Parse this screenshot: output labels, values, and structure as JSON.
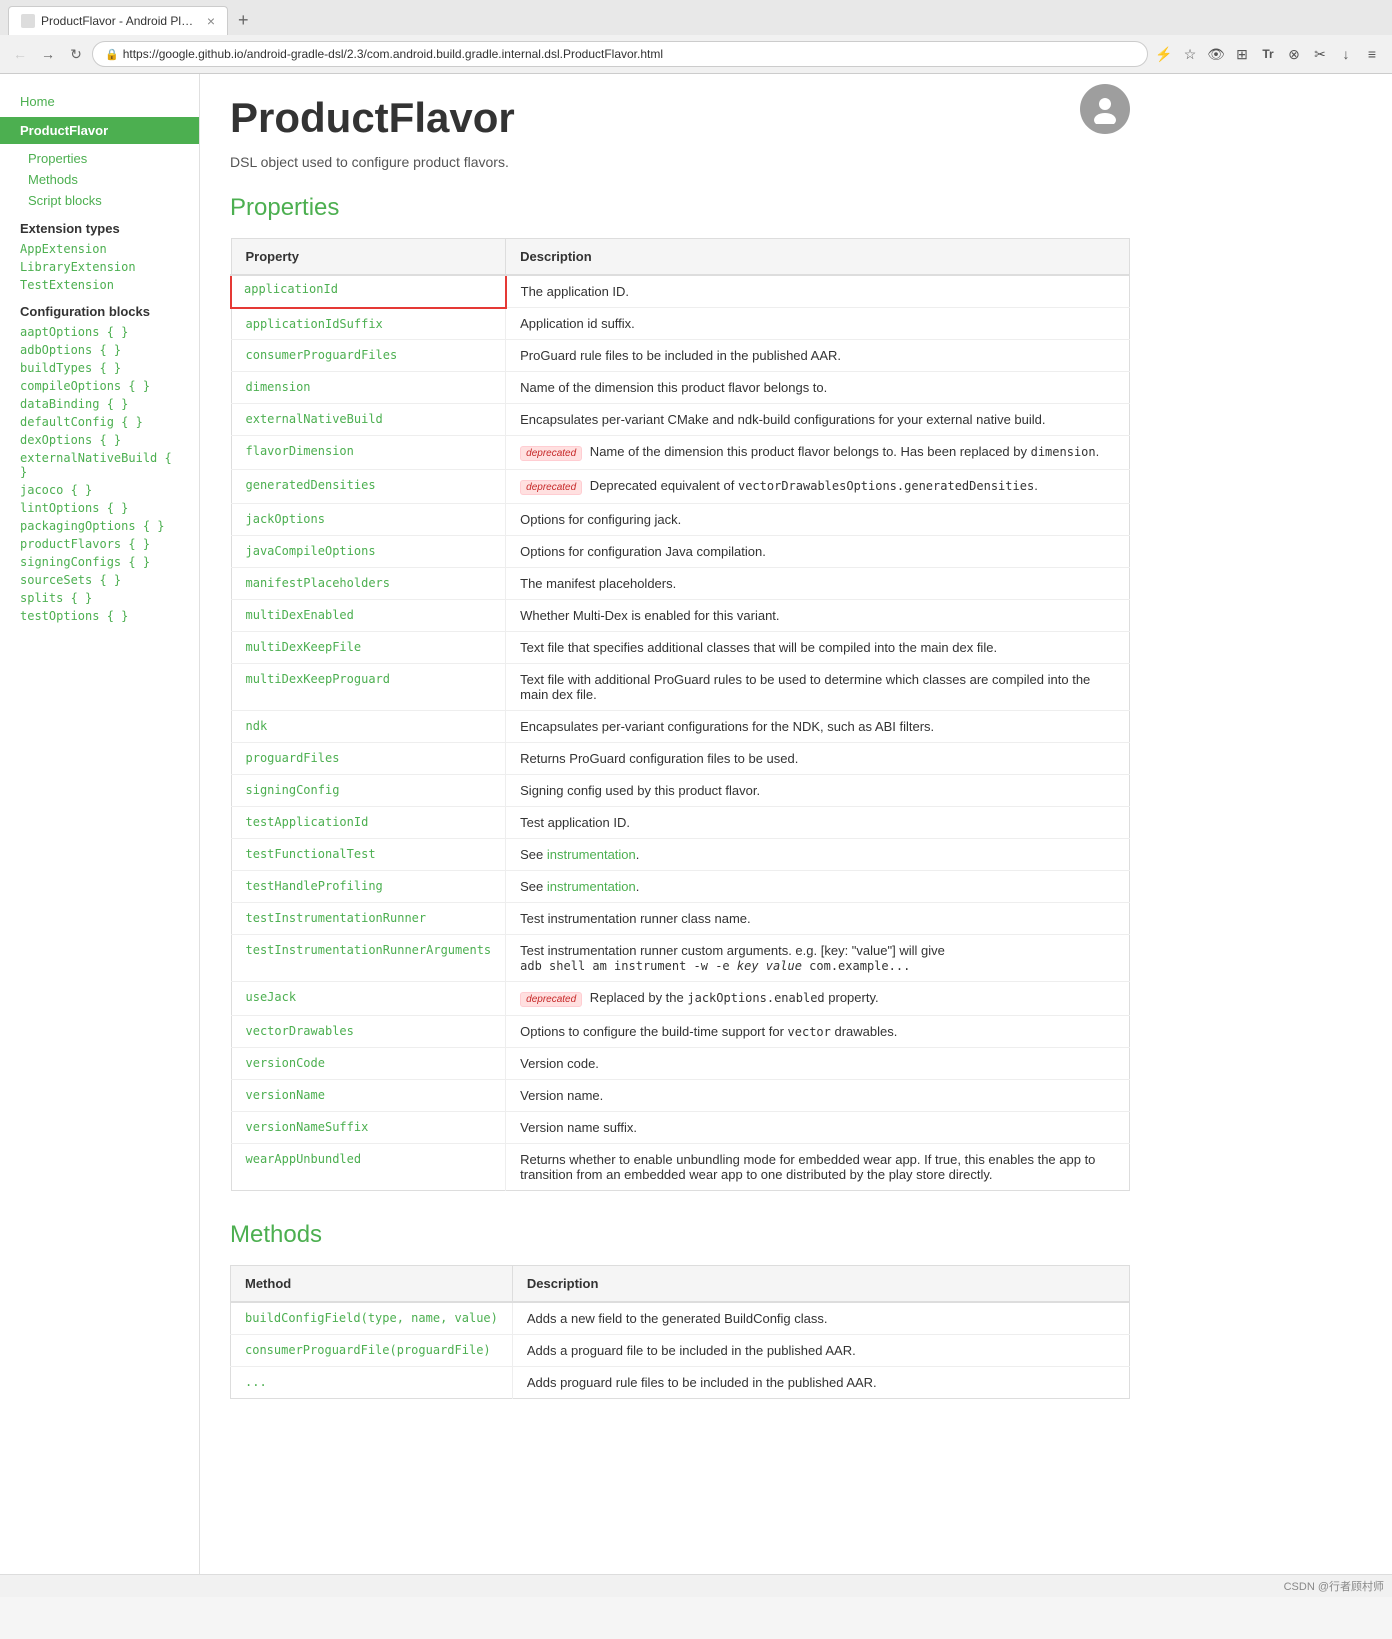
{
  "browser": {
    "tab_title": "ProductFlavor - Android Plugi...",
    "url": "https://google.github.io/android-gradle-dsl/2.3/com.android.build.gradle.internal.dsl.ProductFlavor.html",
    "nav_back": "←",
    "nav_forward": "→",
    "nav_refresh": "↻",
    "toolbar_icons": [
      "⚡",
      "☆",
      "👁",
      "⊞",
      "Tr",
      "⊗",
      "✂",
      "↓",
      "≡"
    ]
  },
  "sidebar": {
    "home_label": "Home",
    "active_label": "ProductFlavor",
    "sub_items": [
      "Properties",
      "Methods",
      "Script blocks"
    ],
    "extension_types_title": "Extension types",
    "extension_types": [
      "AppExtension",
      "LibraryExtension",
      "TestExtension"
    ],
    "config_blocks_title": "Configuration blocks",
    "config_blocks": [
      "aaptOptions { }",
      "adbOptions { }",
      "buildTypes { }",
      "compileOptions { }",
      "dataBinding { }",
      "defaultConfig { }",
      "dexOptions { }",
      "externalNativeBuild { }",
      "jacoco { }",
      "lintOptions { }",
      "packagingOptions { }",
      "productFlavors { }",
      "signingConfigs { }",
      "sourceSets { }",
      "splits { }",
      "testOptions { }"
    ]
  },
  "main": {
    "page_title": "ProductFlavor",
    "page_subtitle": "DSL object used to configure product flavors.",
    "properties_section_title": "Properties",
    "properties_table": {
      "col_property": "Property",
      "col_description": "Description",
      "rows": [
        {
          "property": "applicationId",
          "description": "The application ID.",
          "highlighted": true
        },
        {
          "property": "applicationIdSuffix",
          "description": "Application id suffix."
        },
        {
          "property": "consumerProguardFiles",
          "description": "ProGuard rule files to be included in the published AAR."
        },
        {
          "property": "dimension",
          "description": "Name of the dimension this product flavor belongs to."
        },
        {
          "property": "externalNativeBuild",
          "description": "Encapsulates per-variant CMake and ndk-build configurations for your external native build."
        },
        {
          "property": "flavorDimension",
          "description": "deprecated Name of the dimension this product flavor belongs to. Has been replaced by dimension.",
          "deprecated": true,
          "deprecated_code": "dimension"
        },
        {
          "property": "generatedDensities",
          "description": "deprecated Deprecated equivalent of vectorDrawablesOptions.generatedDensities.",
          "deprecated": true,
          "deprecated_code": "vectorDrawablesOptions.generatedDensities"
        },
        {
          "property": "jackOptions",
          "description": "Options for configuring jack."
        },
        {
          "property": "javaCompileOptions",
          "description": "Options for configuration Java compilation."
        },
        {
          "property": "manifestPlaceholders",
          "description": "The manifest placeholders."
        },
        {
          "property": "multiDexEnabled",
          "description": "Whether Multi-Dex is enabled for this variant."
        },
        {
          "property": "multiDexKeepFile",
          "description": "Text file that specifies additional classes that will be compiled into the main dex file."
        },
        {
          "property": "multiDexKeepProguard",
          "description": "Text file with additional ProGuard rules to be used to determine which classes are compiled into the main dex file."
        },
        {
          "property": "ndk",
          "description": "Encapsulates per-variant configurations for the NDK, such as ABI filters."
        },
        {
          "property": "proguardFiles",
          "description": "Returns ProGuard configuration files to be used."
        },
        {
          "property": "signingConfig",
          "description": "Signing config used by this product flavor."
        },
        {
          "property": "testApplicationId",
          "description": "Test application ID."
        },
        {
          "property": "testFunctionalTest",
          "description": "See instrumentation.",
          "link": "instrumentation"
        },
        {
          "property": "testHandleProfiling",
          "description": "See instrumentation.",
          "link": "instrumentation"
        },
        {
          "property": "testInstrumentationRunner",
          "description": "Test instrumentation runner class name."
        },
        {
          "property": "testInstrumentationRunnerArguments",
          "description": "Test instrumentation runner custom arguments. e.g. [key: \"value\"] will give adb shell am instrument -w -e key value com.example...",
          "has_code": true
        },
        {
          "property": "useJack",
          "description": "deprecated Replaced by the jackOptions.enabled property.",
          "deprecated": true,
          "deprecated_code": "jackOptions.enabled"
        },
        {
          "property": "vectorDrawables",
          "description": "Options to configure the build-time support for vector drawables."
        },
        {
          "property": "versionCode",
          "description": "Version code."
        },
        {
          "property": "versionName",
          "description": "Version name."
        },
        {
          "property": "versionNameSuffix",
          "description": "Version name suffix."
        },
        {
          "property": "wearAppUnbundled",
          "description": "Returns whether to enable unbundling mode for embedded wear app. If true, this enables the app to transition from an embedded wear app to one distributed by the play store directly."
        }
      ]
    },
    "methods_section_title": "Methods",
    "methods_table": {
      "col_method": "Method",
      "col_description": "Description",
      "rows": [
        {
          "method": "buildConfigField(type, name, value)",
          "description": "Adds a new field to the generated BuildConfig class."
        },
        {
          "method": "consumerProguardFile(proguardFile)",
          "description": "Adds a proguard file to be included in the published AAR."
        },
        {
          "method": "...",
          "description": "Adds proguard rule files to be included in the published AAR."
        }
      ]
    }
  }
}
